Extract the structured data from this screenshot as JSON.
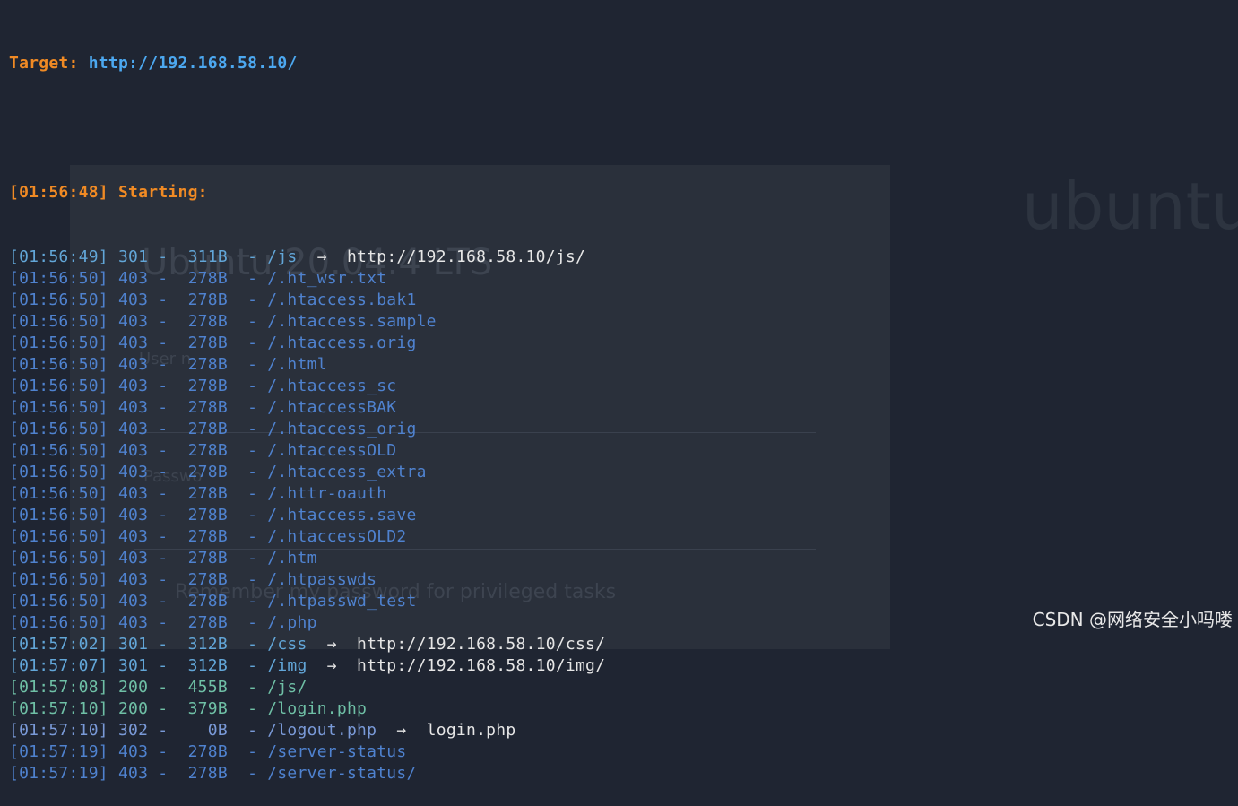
{
  "target": {
    "label": "Target",
    "url": "http://192.168.58.10/"
  },
  "start": {
    "time": "[01:56:48]",
    "label": "Starting:"
  },
  "results": [
    {
      "time": "[01:56:49]",
      "code": "301",
      "size": "311B",
      "path": "/js",
      "redirect": "http://192.168.58.10/js/"
    },
    {
      "time": "[01:56:50]",
      "code": "403",
      "size": "278B",
      "path": "/.ht_wsr.txt"
    },
    {
      "time": "[01:56:50]",
      "code": "403",
      "size": "278B",
      "path": "/.htaccess.bak1"
    },
    {
      "time": "[01:56:50]",
      "code": "403",
      "size": "278B",
      "path": "/.htaccess.sample"
    },
    {
      "time": "[01:56:50]",
      "code": "403",
      "size": "278B",
      "path": "/.htaccess.orig"
    },
    {
      "time": "[01:56:50]",
      "code": "403",
      "size": "278B",
      "path": "/.html"
    },
    {
      "time": "[01:56:50]",
      "code": "403",
      "size": "278B",
      "path": "/.htaccess_sc"
    },
    {
      "time": "[01:56:50]",
      "code": "403",
      "size": "278B",
      "path": "/.htaccessBAK"
    },
    {
      "time": "[01:56:50]",
      "code": "403",
      "size": "278B",
      "path": "/.htaccess_orig"
    },
    {
      "time": "[01:56:50]",
      "code": "403",
      "size": "278B",
      "path": "/.htaccessOLD"
    },
    {
      "time": "[01:56:50]",
      "code": "403",
      "size": "278B",
      "path": "/.htaccess_extra"
    },
    {
      "time": "[01:56:50]",
      "code": "403",
      "size": "278B",
      "path": "/.httr-oauth"
    },
    {
      "time": "[01:56:50]",
      "code": "403",
      "size": "278B",
      "path": "/.htaccess.save"
    },
    {
      "time": "[01:56:50]",
      "code": "403",
      "size": "278B",
      "path": "/.htaccessOLD2"
    },
    {
      "time": "[01:56:50]",
      "code": "403",
      "size": "278B",
      "path": "/.htm"
    },
    {
      "time": "[01:56:50]",
      "code": "403",
      "size": "278B",
      "path": "/.htpasswds"
    },
    {
      "time": "[01:56:50]",
      "code": "403",
      "size": "278B",
      "path": "/.htpasswd_test"
    },
    {
      "time": "[01:56:50]",
      "code": "403",
      "size": "278B",
      "path": "/.php"
    },
    {
      "time": "[01:57:02]",
      "code": "301",
      "size": "312B",
      "path": "/css",
      "redirect": "http://192.168.58.10/css/"
    },
    {
      "time": "[01:57:07]",
      "code": "301",
      "size": "312B",
      "path": "/img",
      "redirect": "http://192.168.58.10/img/"
    },
    {
      "time": "[01:57:08]",
      "code": "200",
      "size": "455B",
      "path": "/js/"
    },
    {
      "time": "[01:57:10]",
      "code": "200",
      "size": "379B",
      "path": "/login.php"
    },
    {
      "time": "[01:57:10]",
      "code": "302",
      "size": "0B",
      "path": "/logout.php",
      "redirect": "login.php"
    },
    {
      "time": "[01:57:19]",
      "code": "403",
      "size": "278B",
      "path": "/server-status"
    },
    {
      "time": "[01:57:19]",
      "code": "403",
      "size": "278B",
      "path": "/server-status/"
    }
  ],
  "background": {
    "title": "Ubuntu 20.04.4 LTS",
    "username_label": "User n",
    "password_label": "Passwo",
    "remember_text": "Remember my password for privileged tasks",
    "logo": "ubuntu"
  },
  "watermark": "CSDN @网络安全小吗喽",
  "colors": {
    "background": "#1f2532",
    "orange": "#f08a24",
    "blue": "#4ca8f0",
    "code_403": "#4f82cf",
    "code_301": "#62a6d8",
    "code_200": "#6fc0a6"
  }
}
